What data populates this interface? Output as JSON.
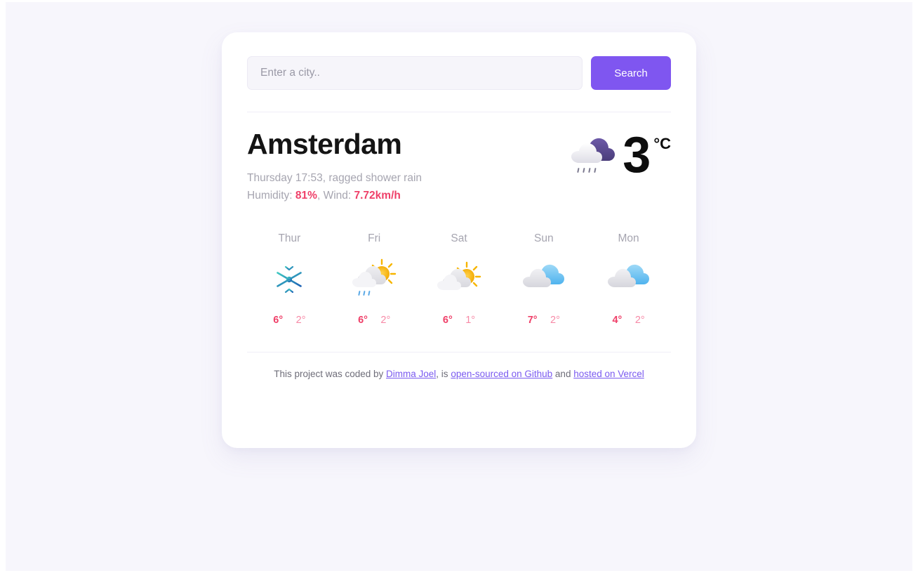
{
  "colors": {
    "page_background": "#f7f6fc",
    "card_background": "#ffffff",
    "accent_purple": "#7f56f0",
    "temp_max_pink": "#ef4069",
    "temp_min_pink": "#f78aa7",
    "muted_gray": "#a6a5b0"
  },
  "search": {
    "placeholder": "Enter a city..",
    "value": "",
    "button_label": "Search"
  },
  "current": {
    "city": "Amsterdam",
    "condition_line": "Thursday 17:53, ragged shower rain",
    "humidity_label": "Humidity: ",
    "humidity_value": "81%",
    "separator": ", ",
    "wind_label": "Wind: ",
    "wind_value": "7.72km/h",
    "temperature": "3",
    "unit": "°C",
    "icon": "shower-rain-icon"
  },
  "forecast": {
    "days": [
      {
        "label": "Thur",
        "icon": "snowflake-icon",
        "max": "6°",
        "min": "2°"
      },
      {
        "label": "Fri",
        "icon": "sun-cloud-rain-icon",
        "max": "6°",
        "min": "2°"
      },
      {
        "label": "Sat",
        "icon": "sun-cloud-icon",
        "max": "6°",
        "min": "1°"
      },
      {
        "label": "Sun",
        "icon": "broken-clouds-icon",
        "max": "7°",
        "min": "2°"
      },
      {
        "label": "Mon",
        "icon": "broken-clouds-icon",
        "max": "4°",
        "min": "2°"
      }
    ]
  },
  "footer": {
    "prefix": "This project was coded by ",
    "author_link": "Dimma Joel",
    "middle": ", is ",
    "github_link": "open-sourced on Github",
    "conjunction": " and ",
    "vercel_link": "hosted on Vercel"
  }
}
